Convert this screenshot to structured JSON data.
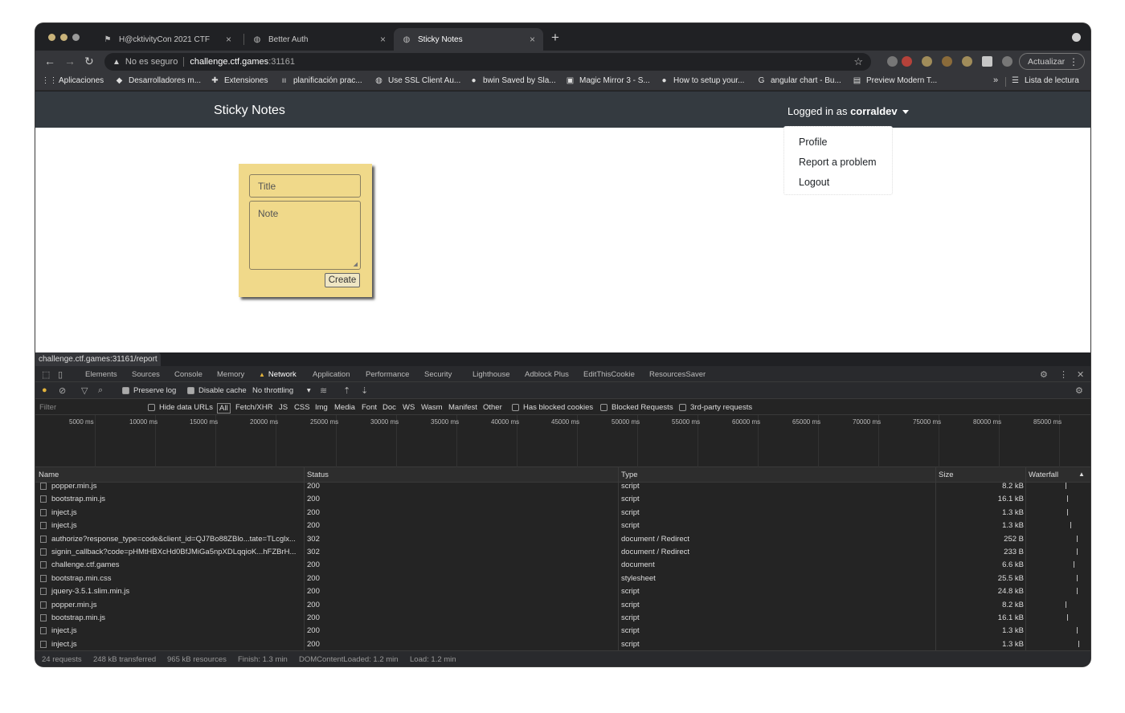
{
  "tabs": [
    {
      "title": "H@cktivityCon 2021 CTF",
      "icon": "flag-icon",
      "active": false
    },
    {
      "title": "Better Auth",
      "icon": "globe-icon",
      "active": false
    },
    {
      "title": "Sticky Notes",
      "icon": "globe-icon",
      "active": true
    }
  ],
  "omnibox": {
    "security": "No es seguro",
    "host": "challenge.ctf.games",
    "port": ":31161"
  },
  "toolbar": {
    "update_label": "Actualizar"
  },
  "bookmarks": [
    {
      "label": "Aplicaciones",
      "icon": "apps-grid-icon"
    },
    {
      "label": "Desarrolladores m...",
      "icon": "bookmark-logo-icon"
    },
    {
      "label": "Extensiones",
      "icon": "puzzle-icon"
    },
    {
      "label": "planificación prac...",
      "icon": "bookmark-logo-icon"
    },
    {
      "label": "Use SSL Client Au...",
      "icon": "globe-icon"
    },
    {
      "label": "bwin Saved by Sla...",
      "icon": "bookmark-logo-icon"
    },
    {
      "label": "Magic Mirror 3 - S...",
      "icon": "bookmark-logo-icon"
    },
    {
      "label": "How to setup your...",
      "icon": "github-icon"
    },
    {
      "label": "angular chart - Bu...",
      "icon": "google-icon"
    },
    {
      "label": "Preview Modern T...",
      "icon": "bookmark-logo-icon"
    }
  ],
  "reading_list": "Lista de lectura",
  "app": {
    "brand": "Sticky Notes",
    "logged_prefix": "Logged in as ",
    "username": "corraldev",
    "menu": [
      "Profile",
      "Report a problem",
      "Logout"
    ],
    "note_form": {
      "title_placeholder": "Title",
      "note_placeholder": "Note",
      "create_label": "Create"
    }
  },
  "status_url": "challenge.ctf.games:31161/report",
  "devtools": {
    "tabs": [
      "Elements",
      "Sources",
      "Console",
      "Memory",
      "Network",
      "Application",
      "Performance",
      "Security",
      "Lighthouse",
      "Adblock Plus",
      "EditThisCookie",
      "ResourcesSaver"
    ],
    "active_tab": "Network",
    "preserve_log": "Preserve log",
    "disable_cache": "Disable cache",
    "throttling": "No throttling",
    "filter_placeholder": "Filter",
    "hide_data_urls": "Hide data URLs",
    "all_label": "All",
    "types": [
      "Fetch/XHR",
      "JS",
      "CSS",
      "Img",
      "Media",
      "Font",
      "Doc",
      "WS",
      "Wasm",
      "Manifest",
      "Other"
    ],
    "blocked_cookies": "Has blocked cookies",
    "blocked_requests": "Blocked Requests",
    "third_party": "3rd-party requests",
    "timeline_ticks": [
      "5000 ms",
      "10000 ms",
      "15000 ms",
      "20000 ms",
      "25000 ms",
      "30000 ms",
      "35000 ms",
      "40000 ms",
      "45000 ms",
      "50000 ms",
      "55000 ms",
      "60000 ms",
      "65000 ms",
      "70000 ms",
      "75000 ms",
      "80000 ms",
      "85000 ms"
    ],
    "columns": [
      "Name",
      "Status",
      "Type",
      "Size",
      "Waterfall"
    ],
    "rows": [
      {
        "name": "popper.min.js",
        "status": "200",
        "type": "script",
        "size": "8.2 kB"
      },
      {
        "name": "bootstrap.min.js",
        "status": "200",
        "type": "script",
        "size": "16.1 kB"
      },
      {
        "name": "inject.js",
        "status": "200",
        "type": "script",
        "size": "1.3 kB"
      },
      {
        "name": "inject.js",
        "status": "200",
        "type": "script",
        "size": "1.3 kB"
      },
      {
        "name": "authorize?response_type=code&client_id=QJ7Bo88ZBlo...tate=TLcglx...",
        "status": "302",
        "type": "document / Redirect",
        "size": "252 B"
      },
      {
        "name": "signin_callback?code=pHMtHBXcHd0BfJMiGa5npXDLqqioK...hFZBrH...",
        "status": "302",
        "type": "document / Redirect",
        "size": "233 B"
      },
      {
        "name": "challenge.ctf.games",
        "status": "200",
        "type": "document",
        "size": "6.6 kB"
      },
      {
        "name": "bootstrap.min.css",
        "status": "200",
        "type": "stylesheet",
        "size": "25.5 kB"
      },
      {
        "name": "jquery-3.5.1.slim.min.js",
        "status": "200",
        "type": "script",
        "size": "24.8 kB"
      },
      {
        "name": "popper.min.js",
        "status": "200",
        "type": "script",
        "size": "8.2 kB"
      },
      {
        "name": "bootstrap.min.js",
        "status": "200",
        "type": "script",
        "size": "16.1 kB"
      },
      {
        "name": "inject.js",
        "status": "200",
        "type": "script",
        "size": "1.3 kB"
      },
      {
        "name": "inject.js",
        "status": "200",
        "type": "script",
        "size": "1.3 kB"
      }
    ],
    "summary": [
      "24 requests",
      "248 kB transferred",
      "965 kB resources",
      "Finish: 1.3 min",
      "DOMContentLoaded: 1.2 min",
      "Load: 1.2 min"
    ]
  }
}
